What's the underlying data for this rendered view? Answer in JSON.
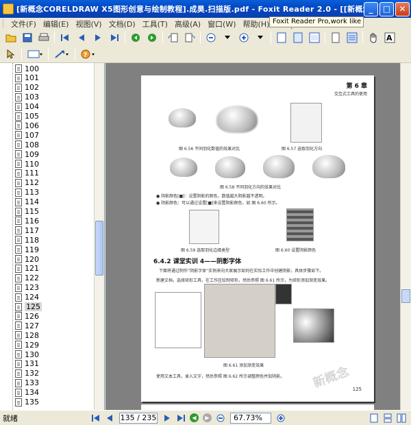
{
  "window": {
    "title": "[新概念CORELDRAW X5图形创意与绘制教程].成昊.扫描版.pdf - Foxit Reader 2.0 - [[新概念CO...",
    "min_symbol": "_",
    "max_symbol": "□",
    "close_symbol": "✕"
  },
  "menu": {
    "items": [
      "文件(F)",
      "编辑(E)",
      "视图(V)",
      "文档(D)",
      "工具(T)",
      "高级(A)",
      "窗口(W)",
      "帮助(H)"
    ],
    "promo": "Foxit Reader Pro,work like a pro!"
  },
  "bookmarks": {
    "items": [
      "100",
      "101",
      "102",
      "103",
      "104",
      "105",
      "106",
      "107",
      "108",
      "109",
      "110",
      "111",
      "112",
      "113",
      "114",
      "115",
      "116",
      "117",
      "118",
      "119",
      "120",
      "121",
      "122",
      "123",
      "124",
      "125",
      "126",
      "127",
      "128",
      "129",
      "130",
      "131",
      "132",
      "133",
      "134",
      "135"
    ],
    "selected": "125"
  },
  "page": {
    "chapter": "第 6 章",
    "chapter_sub": "交互式工具的使用",
    "fig_656": "图 6.56  不同羽化数值的效果对比",
    "fig_657": "图 6.57  选取羽化方向",
    "fig_658": "图 6.58  不同羽化方向的效果对比",
    "bullet1": "● 阴影颜色[■]：设置阴影的颜色，数值越大阴影越不透明。",
    "bullet2": "● 阴影颜色：可以通过设置[■]来设置阴影颜色，如 图 6.60 所示。",
    "fig_659": "图 6.59  选取羽化边缘类型",
    "fig_660": "图 6.60  设置阴影颜色",
    "section": "6.4.2  课堂实训 4——阴影字体",
    "para1": "下面将通过制作“阴影字体”实例来向大家展示如何在实际工作中创建阴影，具体步骤如下。",
    "step1": "新建文档，选择矩形工具，在工作区绘制矩形，然后参照 图 6.61 所示，为矩形添加渐变效果。",
    "fig_661": "图 6.61  添加渐变效果",
    "step2": "使用文本工具，录入文字，然后参照 图 6.62 所示调整颜色并加阴影。",
    "page_no": "125",
    "watermark": "新概念"
  },
  "status": {
    "ready": "就绪",
    "page_display": "135 / 235",
    "zoom": "67.73%"
  },
  "colors": {
    "titlebar": "#0a5fd8",
    "chrome": "#ece9d8",
    "doc_bg": "#808080"
  }
}
